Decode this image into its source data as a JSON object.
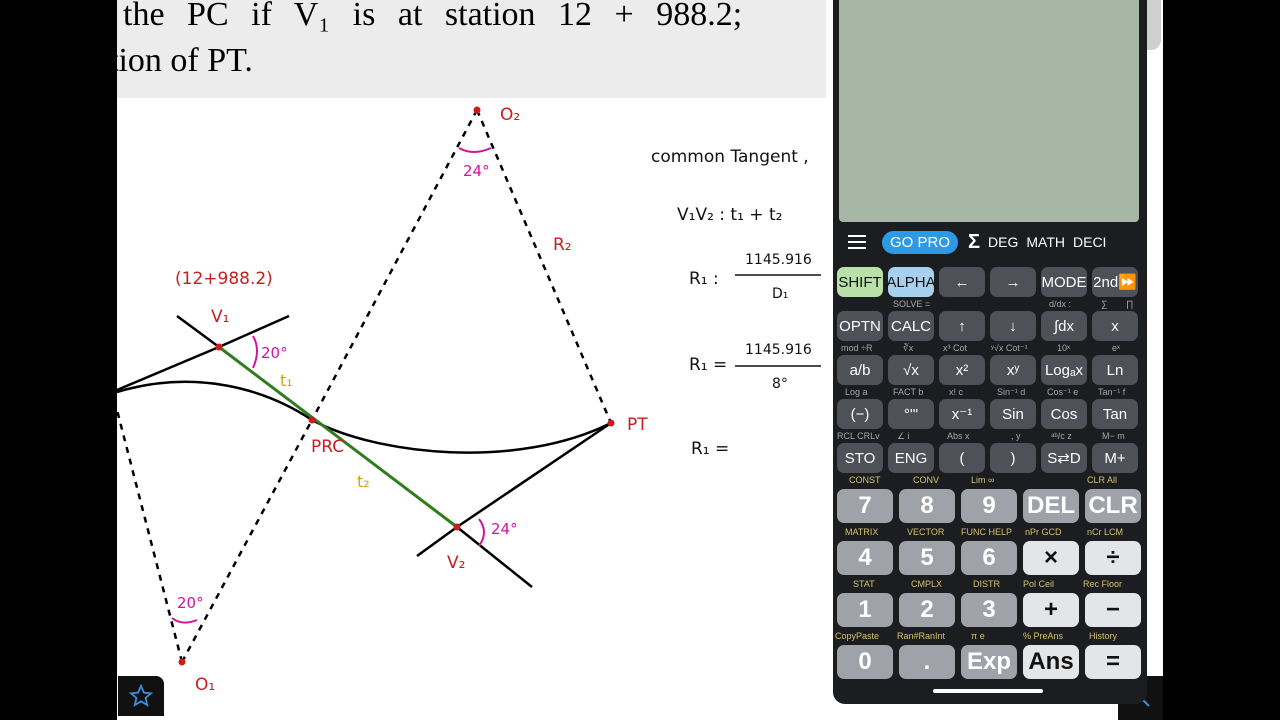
{
  "problem": {
    "line1": "the PC if V₁ is at station 12 + 988.2;",
    "line2": "tion of PT."
  },
  "diagram": {
    "station_label": "(12+988.2)",
    "v1_label": "V₁",
    "v2_label": "V₂",
    "o1_label": "O₁",
    "o2_label": "O₂",
    "prc_label": "PRC",
    "pt_label": "PT",
    "t1_label": "t₁",
    "t2_label": "t₂",
    "r2_label": "R₂",
    "angle_v1": "20°",
    "angle_v2": "24°",
    "angle_o1": "20°",
    "angle_o2": "24°"
  },
  "notes": {
    "common_tangent": "common Tangent ,",
    "eq_v1v2": "V₁V₂ : t₁ + t₂",
    "r1_lhs": "R₁ :",
    "r1_num": "1145.916",
    "r1_den": "D₁",
    "r1b_lhs": "R₁ =",
    "r1b_num": "1145.916",
    "r1b_den": "8°",
    "r1c_lhs": "R₁ ="
  },
  "calculator": {
    "toolbar": {
      "go_pro": "GO PRO",
      "sigma": "Σ",
      "deg": "DEG",
      "math": "MATH",
      "deci": "DECI"
    },
    "row1": [
      "SHIFT",
      "ALPHA",
      "←",
      "→",
      "MODE",
      "2nd⏩"
    ],
    "row1_subs": [
      "SOLVE =",
      "d/dx :",
      "∑",
      "∏"
    ],
    "row2": [
      "OPTN",
      "CALC",
      "↑",
      "↓",
      "∫dx",
      "x"
    ],
    "row2_subs": [
      "mod ÷R",
      "∛x",
      "x³ Cot",
      "ʸ√x Cot⁻¹",
      "10ˣ",
      "eˣ"
    ],
    "row3": [
      "a/b",
      "√x",
      "x²",
      "xʸ",
      "Logₐx",
      "Ln"
    ],
    "row3_subs": [
      "Log a",
      "FACT b",
      "x! c",
      "Sin⁻¹ d",
      "Cos⁻¹ e",
      "Tan⁻¹ f"
    ],
    "row4": [
      "(−)",
      "°'\"",
      "x⁻¹",
      "Sin",
      "Cos",
      "Tan"
    ],
    "row4_subs": [
      "RCL CRLv",
      "∠ i",
      "Abs x",
      ", y",
      "ᵃᵇ/c z",
      "M− m"
    ],
    "row5": [
      "STO",
      "ENG",
      "(",
      ")",
      "S⇄D",
      "M+"
    ],
    "row5_subs": [
      "CONST",
      "CONV",
      "Lim ∞",
      "CLR All"
    ],
    "row6": [
      "7",
      "8",
      "9",
      "DEL",
      "CLR"
    ],
    "row6_subs": [
      "MATRIX",
      "VECTOR",
      "FUNC HELP",
      "nPr GCD",
      "nCr LCM"
    ],
    "row7": [
      "4",
      "5",
      "6",
      "×",
      "÷"
    ],
    "row7_subs": [
      "STAT",
      "CMPLX",
      "DISTR",
      "Pol Ceil",
      "Rec Floor"
    ],
    "row8": [
      "1",
      "2",
      "3",
      "+",
      "−"
    ],
    "row8_subs": [
      "CopyPaste",
      "Ran#RanInt",
      "π e",
      "% PreAns",
      "History"
    ],
    "row9": [
      "0",
      ".",
      "Exp",
      "Ans",
      "="
    ]
  },
  "colors": {
    "accent": "#2e9ae6",
    "shift": "#b8e0a8",
    "alpha": "#a7d0ef",
    "magenta": "#d0159a",
    "red": "#c81d1d",
    "gold": "#d4a017",
    "green_line": "#2f7d1e"
  }
}
